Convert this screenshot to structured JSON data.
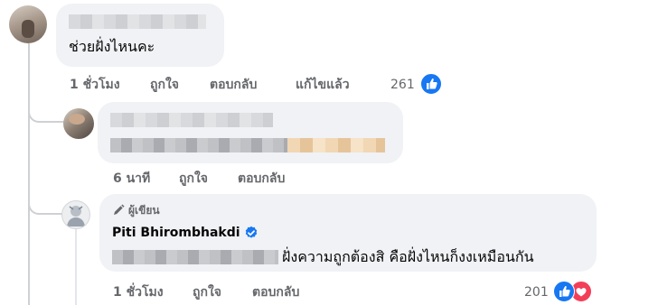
{
  "comments": [
    {
      "text": "ช่วยฝั่งไหนคะ",
      "actions": {
        "time": "1 ชั่วโมง",
        "like": "ถูกใจ",
        "reply": "ตอบกลับ",
        "edited": "แก้ไขแล้ว"
      },
      "reaction_count": "261"
    },
    {
      "actions": {
        "time": "6 นาที",
        "like": "ถูกใจ",
        "reply": "ตอบกลับ"
      }
    },
    {
      "author_badge": "ผู้เขียน",
      "author_name": "Piti Bhirombhakdi",
      "text": "ฝั่งความถูกต้องสิ คือฝั่งไหนก็งงเหมือนกัน",
      "actions": {
        "time": "1 ชั่วโมง",
        "like": "ถูกใจ",
        "reply": "ตอบกลับ"
      },
      "reaction_count": "201"
    }
  ],
  "colors": {
    "like_blue": "#1877f2",
    "love_red": "#f33e58",
    "verified_blue": "#1877f2",
    "bubble_bg": "#f0f2f5",
    "meta_gray": "#65676b"
  }
}
